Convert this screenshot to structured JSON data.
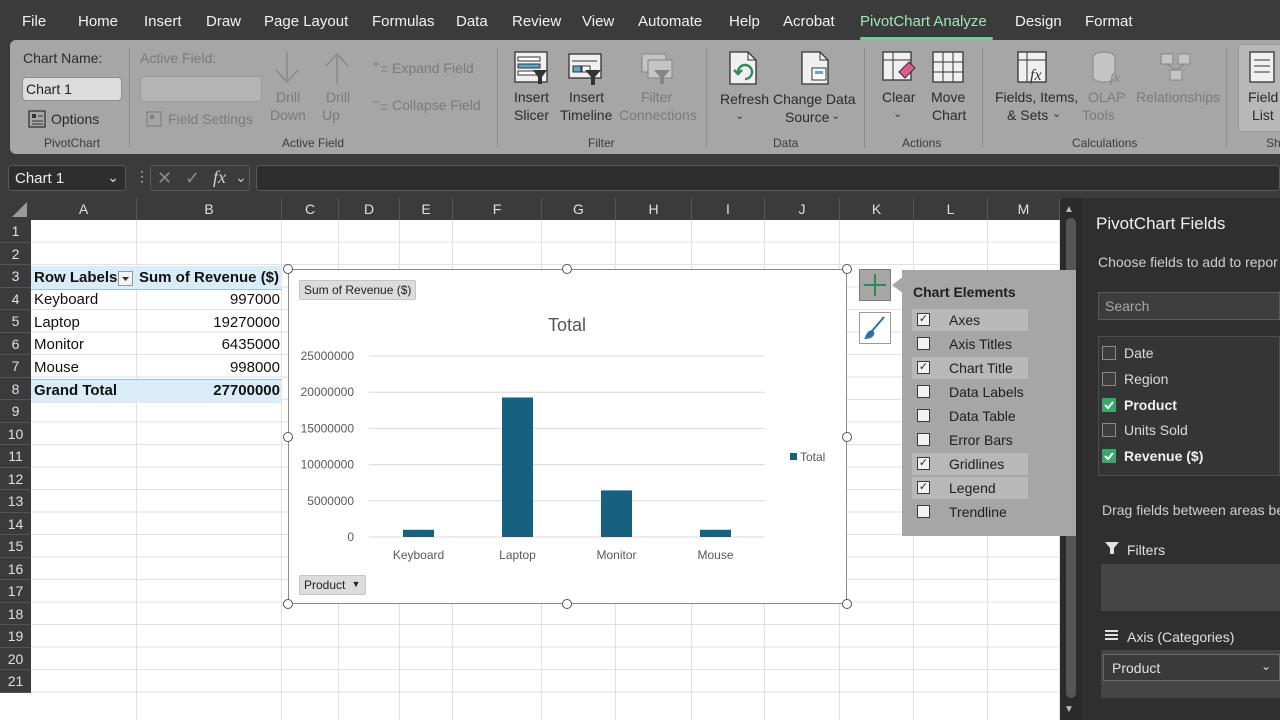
{
  "menu": {
    "items": [
      "File",
      "Home",
      "Insert",
      "Draw",
      "Page Layout",
      "Formulas",
      "Data",
      "Review",
      "View",
      "Automate",
      "Help",
      "Acrobat",
      "PivotChart Analyze",
      "Design",
      "Format"
    ],
    "active": "PivotChart Analyze"
  },
  "ribbon": {
    "chart_name_label": "Chart Name:",
    "chart_name_value": "Chart 1",
    "options_label": "Options",
    "pivotchart_group": "PivotChart",
    "active_field_label": "Active Field:",
    "field_settings": "Field Settings",
    "drill_down_1": "Drill",
    "drill_down_2": "Down",
    "drill_up_1": "Drill",
    "drill_up_2": "Up",
    "expand_field": "Expand Field",
    "collapse_field": "Collapse Field",
    "active_field_group": "Active Field",
    "insert_slicer_1": "Insert",
    "insert_slicer_2": "Slicer",
    "insert_timeline_1": "Insert",
    "insert_timeline_2": "Timeline",
    "filter_connections_1": "Filter",
    "filter_connections_2": "Connections",
    "filter_group": "Filter",
    "refresh": "Refresh",
    "change_data_source_1": "Change Data",
    "change_data_source_2": "Source",
    "data_group": "Data",
    "clear": "Clear",
    "move_chart_1": "Move",
    "move_chart_2": "Chart",
    "actions_group": "Actions",
    "fields_items_sets_1": "Fields, Items,",
    "fields_items_sets_2": "& Sets",
    "olap_tools_1": "OLAP",
    "olap_tools_2": "Tools",
    "relationships": "Relationships",
    "calculations_group": "Calculations",
    "field_list_1": "Field",
    "field_list_2": "List",
    "show_group": "Sh"
  },
  "formula_bar": {
    "name_box": "Chart 1",
    "fx": "fx"
  },
  "sheet": {
    "columns": [
      "A",
      "B",
      "C",
      "D",
      "E",
      "F",
      "G",
      "H",
      "I",
      "J",
      "K",
      "L",
      "M"
    ],
    "rows": [
      "1",
      "2",
      "3",
      "4",
      "5",
      "6",
      "7",
      "8",
      "9",
      "10",
      "11",
      "12",
      "13",
      "14",
      "15",
      "16",
      "17",
      "18",
      "19",
      "20",
      "21"
    ],
    "pivot": {
      "header_labels": "Row Labels",
      "header_value": "Sum of Revenue ($)",
      "rows": [
        {
          "label": "Keyboard",
          "value": "997000"
        },
        {
          "label": "Laptop",
          "value": "19270000"
        },
        {
          "label": "Monitor",
          "value": "6435000"
        },
        {
          "label": "Mouse",
          "value": "998000"
        }
      ],
      "total_label": "Grand Total",
      "total_value": "27700000"
    }
  },
  "chart": {
    "value_field_tag": "Sum of Revenue ($)",
    "axis_field_tag": "Product",
    "legend_label": "Total",
    "bar_color": "#17607f"
  },
  "chart_data": {
    "type": "bar",
    "title": "Total",
    "categories": [
      "Keyboard",
      "Laptop",
      "Monitor",
      "Mouse"
    ],
    "series": [
      {
        "name": "Total",
        "values": [
          997000,
          19270000,
          6435000,
          998000
        ]
      }
    ],
    "ylim": [
      0,
      25000000
    ],
    "yticks": [
      "0",
      "5000000",
      "10000000",
      "15000000",
      "20000000",
      "25000000"
    ],
    "grid": true,
    "legend": "right"
  },
  "chart_elements": {
    "title": "Chart Elements",
    "items": [
      {
        "label": "Axes",
        "checked": true
      },
      {
        "label": "Axis Titles",
        "checked": false
      },
      {
        "label": "Chart Title",
        "checked": true
      },
      {
        "label": "Data Labels",
        "checked": false
      },
      {
        "label": "Data Table",
        "checked": false
      },
      {
        "label": "Error Bars",
        "checked": false
      },
      {
        "label": "Gridlines",
        "checked": true
      },
      {
        "label": "Legend",
        "checked": true
      },
      {
        "label": "Trendline",
        "checked": false
      }
    ]
  },
  "fields_pane": {
    "title": "PivotChart Fields",
    "subtitle": "Choose fields to add to repor",
    "search_placeholder": "Search",
    "fields": [
      {
        "label": "Date",
        "checked": false
      },
      {
        "label": "Region",
        "checked": false
      },
      {
        "label": "Product",
        "checked": true
      },
      {
        "label": "Units Sold",
        "checked": false
      },
      {
        "label": "Revenue ($)",
        "checked": true
      }
    ],
    "drag_text": "Drag fields between areas be",
    "filters_label": "Filters",
    "axis_label": "Axis (Categories)",
    "axis_item": "Product"
  }
}
